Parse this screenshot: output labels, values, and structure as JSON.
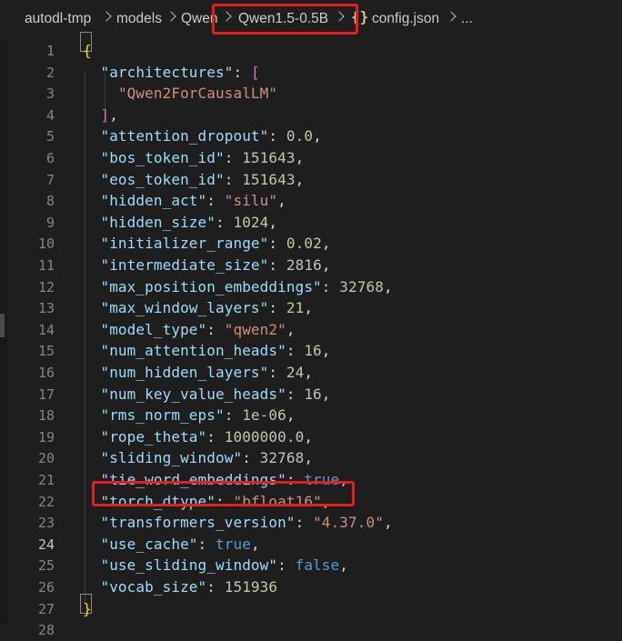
{
  "breadcrumb": {
    "items": [
      "autodl-tmp",
      "models",
      "Qwen",
      "Qwen1.5-0.5B",
      "config.json",
      "..."
    ]
  },
  "editor": {
    "active_line": 24,
    "lines": [
      {
        "num": "1",
        "text": "{"
      },
      {
        "num": "2",
        "text": "  \"architectures\": ["
      },
      {
        "num": "3",
        "text": "    \"Qwen2ForCausalLM\""
      },
      {
        "num": "4",
        "text": "  ],"
      },
      {
        "num": "5",
        "text": "  \"attention_dropout\": 0.0,"
      },
      {
        "num": "6",
        "text": "  \"bos_token_id\": 151643,"
      },
      {
        "num": "7",
        "text": "  \"eos_token_id\": 151643,"
      },
      {
        "num": "8",
        "text": "  \"hidden_act\": \"silu\","
      },
      {
        "num": "9",
        "text": "  \"hidden_size\": 1024,"
      },
      {
        "num": "10",
        "text": "  \"initializer_range\": 0.02,"
      },
      {
        "num": "11",
        "text": "  \"intermediate_size\": 2816,"
      },
      {
        "num": "12",
        "text": "  \"max_position_embeddings\": 32768,"
      },
      {
        "num": "13",
        "text": "  \"max_window_layers\": 21,"
      },
      {
        "num": "14",
        "text": "  \"model_type\": \"qwen2\","
      },
      {
        "num": "15",
        "text": "  \"num_attention_heads\": 16,"
      },
      {
        "num": "16",
        "text": "  \"num_hidden_layers\": 24,"
      },
      {
        "num": "17",
        "text": "  \"num_key_value_heads\": 16,"
      },
      {
        "num": "18",
        "text": "  \"rms_norm_eps\": 1e-06,"
      },
      {
        "num": "19",
        "text": "  \"rope_theta\": 1000000.0,"
      },
      {
        "num": "20",
        "text": "  \"sliding_window\": 32768,"
      },
      {
        "num": "21",
        "text": "  \"tie_word_embeddings\": true,"
      },
      {
        "num": "22",
        "text": "  \"torch_dtype\": \"bfloat16\","
      },
      {
        "num": "23",
        "text": "  \"transformers_version\": \"4.37.0\","
      },
      {
        "num": "24",
        "text": "  \"use_cache\": true,"
      },
      {
        "num": "25",
        "text": "  \"use_sliding_window\": false,"
      },
      {
        "num": "26",
        "text": "  \"vocab_size\": 151936"
      },
      {
        "num": "27",
        "text": "}"
      },
      {
        "num": "28",
        "text": ""
      }
    ]
  },
  "colors": {
    "key": "#9cdcfe",
    "string": "#ce9178",
    "number": "#b5cea8",
    "boolean": "#569cd6",
    "annotation": "#e51f1f"
  },
  "icons": {
    "file_type": "json-braces-icon",
    "separator": "chevron-right-icon"
  }
}
